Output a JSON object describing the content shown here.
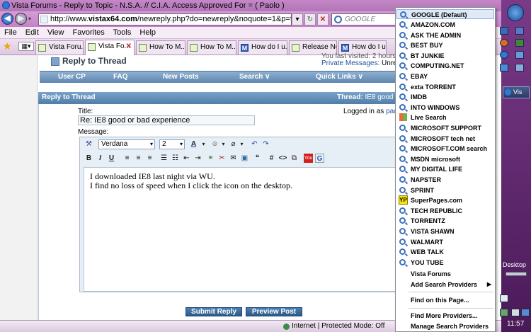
{
  "window": {
    "title": "Vista Forums - Reply to Topic - N.S.A. // C.I.A. Access Approved For = ( Paolo )",
    "address_prefix": "http://www.",
    "address_domain": "vistax64.com",
    "address_path": "/newreply.php?do=newreply&noquote=1&p=998554",
    "search_placeholder": "GOOGLE"
  },
  "menu": [
    "File",
    "Edit",
    "View",
    "Favorites",
    "Tools",
    "Help"
  ],
  "tabs": [
    {
      "label": "Vista Foru..."
    },
    {
      "label": "Vista Fo..."
    },
    {
      "label": "How To M..."
    },
    {
      "label": "How To M..."
    },
    {
      "label": "How do I u..."
    },
    {
      "label": "Release No..."
    },
    {
      "label": "How do I u..."
    }
  ],
  "page": {
    "reply_heading": "Reply to Thread",
    "last_visited": "You last visited: 2 hours",
    "private_messages": "Private Messages:",
    "unread": "Unread",
    "nav": [
      "User CP",
      "FAQ",
      "New Posts",
      "Search ∨",
      "Quick Links ∨"
    ],
    "panel_title": "Reply to Thread",
    "thread_label": "Thread:",
    "thread_name": "IE8 good o",
    "title_label": "Title:",
    "title_value": "Re: IE8 good or bad experience",
    "logged_in": "Logged in as",
    "logged_user": "paol",
    "message_label": "Message:",
    "font_select": "Verdana",
    "size_select": "2",
    "message_line1": "I downloaded IE8 last night via WU.",
    "message_line2": "I find no loss of speed when I click the icon on the desktop.",
    "submit_button": "Submit Reply",
    "preview_button": "Preview Post"
  },
  "status": {
    "zone": "Internet | Protected Mode: Off"
  },
  "providers": {
    "items": [
      "GOOGLE (Default)",
      "AMAZON.COM",
      "ASK THE ADMIN",
      "BEST BUY",
      "BT JUNKIE",
      "COMPUTING.NET",
      "EBAY",
      "exta TORRENT",
      "IMDB",
      "INTO WINDOWS",
      "Live Search",
      "MICROSOFT SUPPORT",
      "MICROSOFT tech net",
      "MICROSOFT.COM search",
      "MSDN microsoft",
      "MY DIGITAL LIFE",
      "NAPSTER",
      "SPRINT",
      "SuperPages.com",
      "TECH REPUBLIC",
      "TORRENTZ",
      "VISTA SHAWN",
      "WALMART",
      "WEB TALK",
      "YOU TUBE"
    ],
    "vista_forums": "Vista Forums",
    "add_providers": "Add Search Providers",
    "find_on_page": "Find on this Page...",
    "find_more": "Find More Providers...",
    "manage": "Manage Search Providers"
  },
  "desktop": {
    "task_label": "Vis",
    "desktop_label": "Desktop",
    "clock": "11:57"
  }
}
